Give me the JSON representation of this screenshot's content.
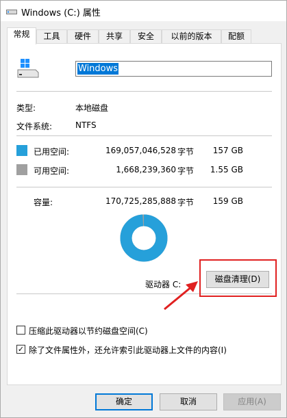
{
  "window": {
    "title": "Windows (C:) 属性"
  },
  "tabs": [
    {
      "label": "常规",
      "active": true
    },
    {
      "label": "工具"
    },
    {
      "label": "硬件"
    },
    {
      "label": "共享"
    },
    {
      "label": "安全"
    },
    {
      "label": "以前的版本"
    },
    {
      "label": "配额"
    }
  ],
  "drive": {
    "name": "Windows",
    "type_label": "类型:",
    "type_value": "本地磁盘",
    "fs_label": "文件系统:",
    "fs_value": "NTFS",
    "used": {
      "label": "已用空间:",
      "bytes": "169,057,046,528",
      "unit": "字节",
      "size": "157 GB",
      "color": "#26a0da"
    },
    "free": {
      "label": "可用空间:",
      "bytes": "1,668,239,360",
      "unit": "字节",
      "size": "1.55 GB",
      "color": "#a0a0a0"
    },
    "capacity": {
      "label": "容量:",
      "bytes": "170,725,285,888",
      "unit": "字节",
      "size": "159 GB"
    },
    "used_fraction": 0.99,
    "drive_label": "驱动器 C:"
  },
  "cleanup_button": "磁盘清理(D)",
  "options": {
    "compress": {
      "label": "压缩此驱动器以节约磁盘空间(C)",
      "checked": false
    },
    "index": {
      "label": "除了文件属性外，还允许索引此驱动器上文件的内容(I)",
      "checked": true
    }
  },
  "buttons": {
    "ok": "确定",
    "cancel": "取消",
    "apply": "应用(A)"
  },
  "colors": {
    "accent": "#0078d7",
    "annotation": "#e02020"
  }
}
